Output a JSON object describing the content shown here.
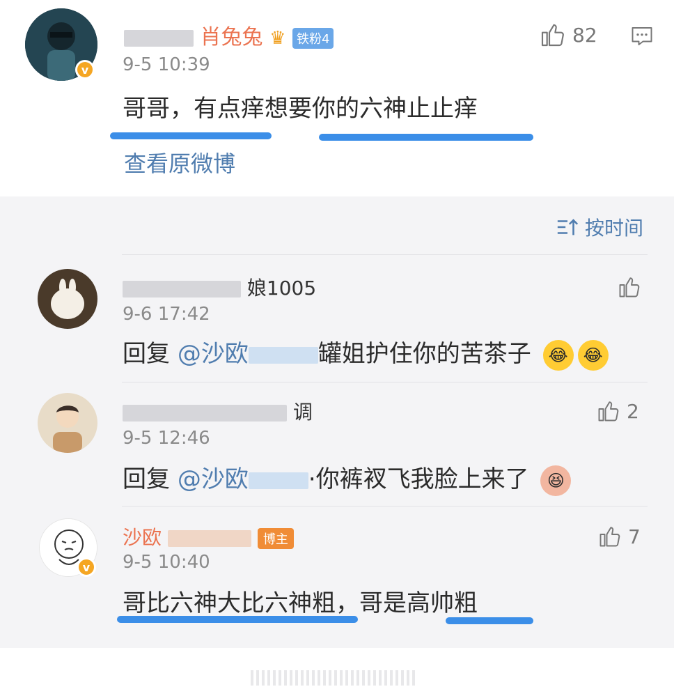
{
  "main_comment": {
    "username": "肖兔兔",
    "fan_badge": "铁粉4",
    "timestamp": "9-5 10:39",
    "text": "哥哥，有点痒想要你的六神止止痒",
    "view_original": "查看原微博",
    "like_count": "82"
  },
  "sort_label": "按时间",
  "replies": [
    {
      "username": "娘1005",
      "timestamp": "9-6 17:42",
      "reply_prefix": "回复",
      "mention": "@沙欧",
      "text": "罐姐护住你的苦茶子",
      "like_count": ""
    },
    {
      "username": "调",
      "timestamp": "9-5 12:46",
      "reply_prefix": "回复",
      "mention": "@沙欧",
      "text": "·你裤衩飞我脸上来了",
      "like_count": "2"
    },
    {
      "username": "沙欧",
      "badge": "博主",
      "timestamp": "9-5 10:40",
      "text": "哥比六神大比六神粗，哥是高帅粗",
      "like_count": "7"
    }
  ],
  "colors": {
    "username_orange": "#eb7350",
    "link_blue": "#507daf",
    "highlight_blue": "#3b8ee8",
    "badge_blue": "#6aa7e8",
    "badge_orange": "#f08c36"
  },
  "icons": [
    "thumbs-up-icon",
    "comment-icon",
    "sort-icon",
    "verified-icon",
    "crown-icon"
  ]
}
